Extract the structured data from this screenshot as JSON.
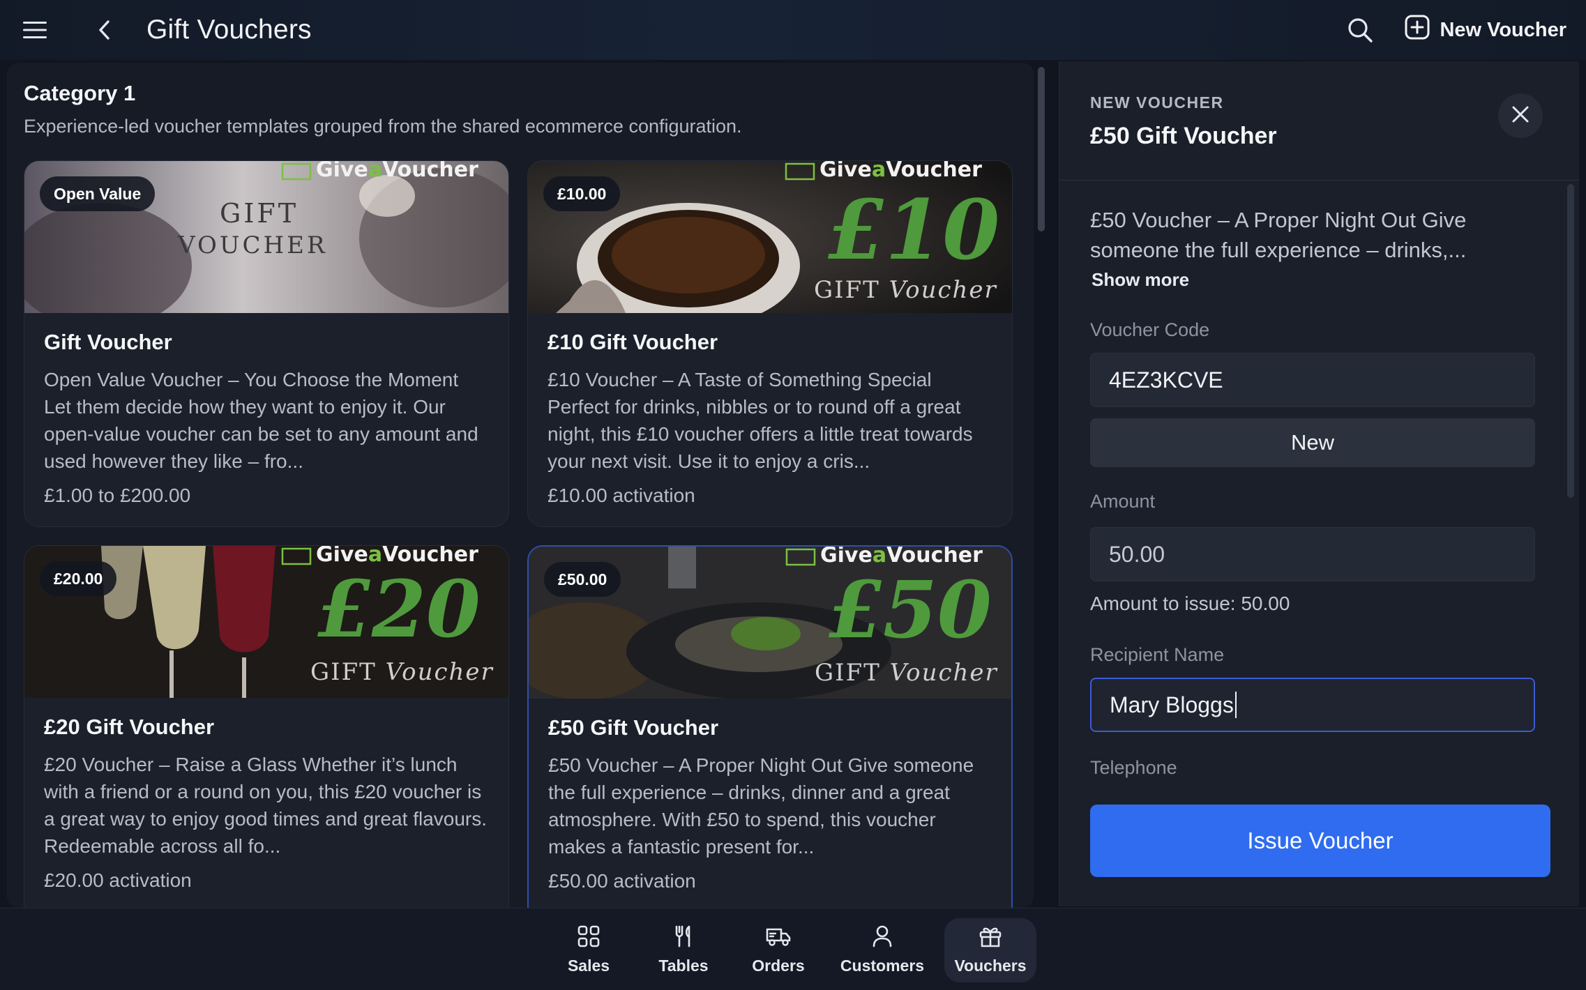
{
  "header": {
    "title": "Gift Vouchers",
    "new_voucher_label": "New Voucher"
  },
  "category": {
    "title": "Category 1",
    "description": "Experience-led voucher templates grouped from the shared ecommerce configuration."
  },
  "cards": [
    {
      "badge": "Open Value",
      "image_text": [
        "Give",
        "a",
        "Voucher",
        "GIFT",
        "VOUCHER"
      ],
      "title": "Gift Voucher",
      "description": "Open Value Voucher – You Choose the Moment Let them decide how they want to enjoy it. Our open-value voucher can be set to any amount and used however they like – fro...",
      "price": "£1.00 to £200.00"
    },
    {
      "badge": "£10.00",
      "image_text": [
        "Give",
        "a",
        "Voucher",
        "£10",
        "GIFT",
        "Voucher"
      ],
      "title": "£10 Gift Voucher",
      "description": "£10 Voucher – A Taste of Something Special Perfect for drinks, nibbles or to round off a great night, this £10 voucher offers a little treat towards your next visit. Use it to enjoy a cris...",
      "price": "£10.00 activation"
    },
    {
      "badge": "£20.00",
      "image_text": [
        "Give",
        "a",
        "Voucher",
        "£20",
        "GIFT",
        "Voucher"
      ],
      "title": "£20 Gift Voucher",
      "description": "£20 Voucher – Raise a Glass Whether it’s lunch with a friend or a round on you, this £20 voucher is a great way to enjoy good times and great flavours. Redeemable across all fo...",
      "price": "£20.00 activation"
    },
    {
      "badge": "£50.00",
      "image_text": [
        "Give",
        "a",
        "Voucher",
        "£50",
        "GIFT",
        "Voucher"
      ],
      "title": "£50 Gift Voucher",
      "description": "£50 Voucher – A Proper Night Out Give someone the full experience – drinks, dinner and a great atmosphere. With £50 to spend, this voucher makes a fantastic present for...",
      "price": "£50.00 activation"
    }
  ],
  "panel": {
    "eyebrow": "NEW VOUCHER",
    "title": "£50 Gift Voucher",
    "description": "£50 Voucher – A Proper Night Out Give someone the full experience – drinks,...",
    "show_more": "Show more",
    "voucher_code_label": "Voucher Code",
    "voucher_code_value": "4EZ3KCVE",
    "new_code_button": "New",
    "amount_label": "Amount",
    "amount_value": "50.00",
    "amount_note": "Amount to issue: 50.00",
    "recipient_label": "Recipient Name",
    "recipient_value": "Mary Bloggs",
    "telephone_label": "Telephone",
    "issue_button": "Issue Voucher"
  },
  "nav": [
    {
      "label": "Sales",
      "icon": "grid-icon"
    },
    {
      "label": "Tables",
      "icon": "fork-knife-icon"
    },
    {
      "label": "Orders",
      "icon": "truck-icon"
    },
    {
      "label": "Customers",
      "icon": "person-icon"
    },
    {
      "label": "Vouchers",
      "icon": "gift-icon",
      "active": true
    }
  ],
  "colors": {
    "accent": "#2f6cf0",
    "logo_green": "#7cc043",
    "background": "#11151f"
  }
}
